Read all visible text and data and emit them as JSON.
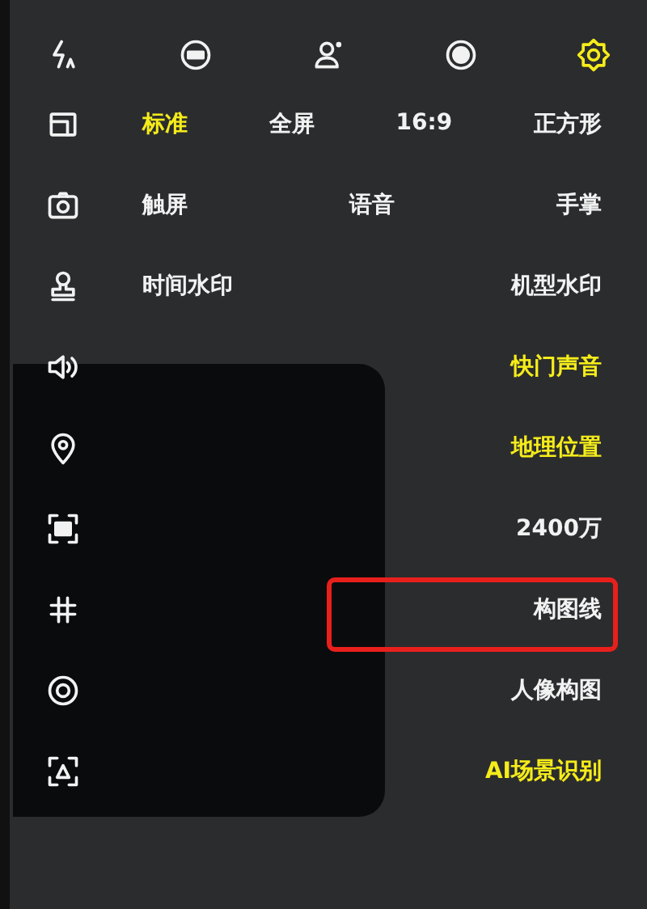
{
  "top_icons": [
    {
      "kind": "flash-auto",
      "selected": false
    },
    {
      "kind": "filter",
      "selected": false
    },
    {
      "kind": "portrait",
      "selected": false
    },
    {
      "kind": "ring",
      "selected": false
    },
    {
      "kind": "gear",
      "selected": true
    }
  ],
  "rows": [
    {
      "kind": "frame",
      "options": [
        {
          "label": "标准",
          "selected": true
        },
        {
          "label": "全屏",
          "selected": false
        },
        {
          "label": "16:9",
          "selected": false
        },
        {
          "label": "正方形",
          "selected": false
        }
      ]
    },
    {
      "kind": "camera",
      "options": [
        {
          "label": "触屏",
          "selected": false
        },
        {
          "label": "语音",
          "selected": false
        },
        {
          "label": "手掌",
          "selected": false
        }
      ]
    },
    {
      "kind": "stamp",
      "options": [
        {
          "label": "时间水印",
          "selected": false
        },
        {
          "label": "机型水印",
          "selected": false
        }
      ]
    },
    {
      "kind": "speaker",
      "options": [
        {
          "label": "快门声音",
          "selected": true
        }
      ]
    },
    {
      "kind": "pin",
      "options": [
        {
          "label": "地理位置",
          "selected": true
        }
      ]
    },
    {
      "kind": "scan",
      "options": [
        {
          "label": "2400万",
          "selected": false
        }
      ]
    },
    {
      "kind": "grid",
      "highlighted": true,
      "options": [
        {
          "label": "构图线",
          "selected": false
        }
      ]
    },
    {
      "kind": "target",
      "options": [
        {
          "label": "人像构图",
          "selected": false
        }
      ]
    },
    {
      "kind": "ai-scan",
      "options": [
        {
          "label": "AI场景识别",
          "selected": true
        }
      ]
    }
  ]
}
